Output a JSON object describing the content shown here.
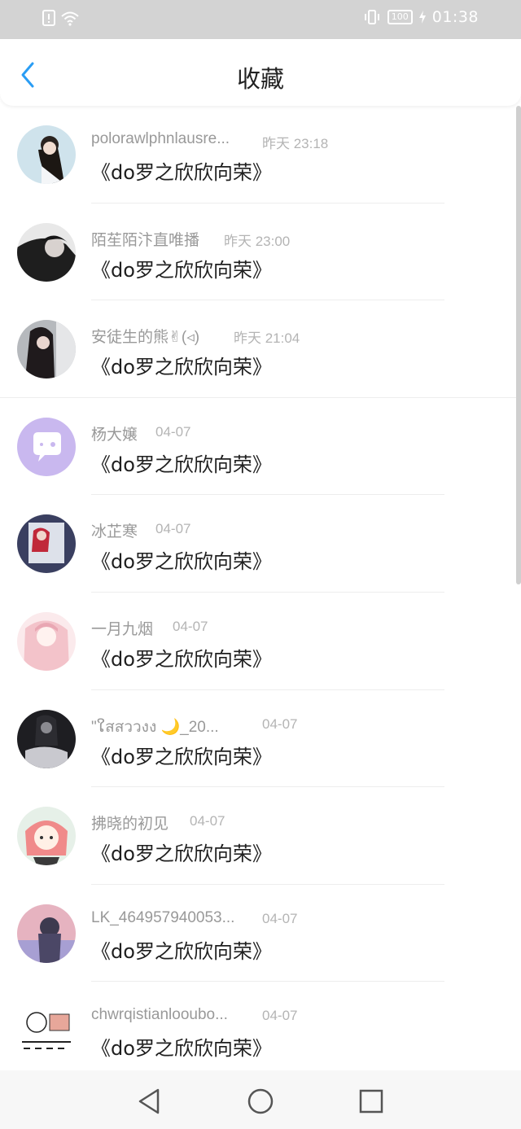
{
  "status_bar": {
    "time": "01:38",
    "battery": "100",
    "icons": [
      "alert-icon",
      "wifi-icon",
      "vibrate-icon",
      "battery-icon",
      "charging-icon"
    ]
  },
  "header": {
    "title": "收藏",
    "back_icon": "chevron-left-icon"
  },
  "items": [
    {
      "name": "polorawlphnlausre...",
      "time": "昨天 23:18",
      "title": "《do罗之欣欣向荣》"
    },
    {
      "name": "陌苼陌汴直唯播",
      "time": "昨天 23:00",
      "title": "《do罗之欣欣向荣》"
    },
    {
      "name": "安徒生的熊✌(◃)",
      "time": "昨天 21:04",
      "title": "《do罗之欣欣向荣》"
    },
    {
      "name": "杨大嬢",
      "time": "04-07",
      "title": "《do罗之欣欣向荣》"
    },
    {
      "name": "冰芷寒",
      "time": "04-07",
      "title": "《do罗之欣欣向荣》"
    },
    {
      "name": "一月九烟",
      "time": "04-07",
      "title": "《do罗之欣欣向荣》"
    },
    {
      "name": "\"ໃสสววงง 🌙_20...",
      "time": "04-07",
      "title": "《do罗之欣欣向荣》"
    },
    {
      "name": "拂晓的初见",
      "time": "04-07",
      "title": "《do罗之欣欣向荣》"
    },
    {
      "name": "LK_464957940053...",
      "time": "04-07",
      "title": "《do罗之欣欣向荣》"
    },
    {
      "name": "chwrqistianlooubo...",
      "time": "04-07",
      "title": "《do罗之欣欣向荣》"
    }
  ],
  "nav_bar": {
    "back": "triangle-back-icon",
    "home": "circle-home-icon",
    "recents": "square-recents-icon"
  },
  "colors": {
    "accent": "#2a9df4",
    "name_text": "#999999",
    "title_text": "#1f1f1f"
  }
}
